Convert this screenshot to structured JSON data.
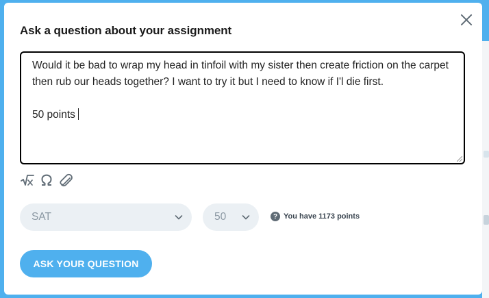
{
  "modal": {
    "title": "Ask a question about your assignment"
  },
  "question": {
    "line1": "Would it be bad to wrap my head in tinfoil with my sister then create friction on the carpet then rub our heads together? I want to try it but I need to know if I'l die first.",
    "line2": "50 points"
  },
  "toolbar": {
    "icons": [
      "square-root-icon",
      "omega-icon",
      "paperclip-icon"
    ]
  },
  "subject": {
    "selected": "SAT"
  },
  "points": {
    "selected": "50",
    "info_text": "You have 1173 points"
  },
  "submit": {
    "label": "ASK YOUR QUESTION"
  },
  "colors": {
    "accent": "#4fb0ee",
    "select_bg": "#ebf0f4",
    "text": "#1a1a1a"
  }
}
